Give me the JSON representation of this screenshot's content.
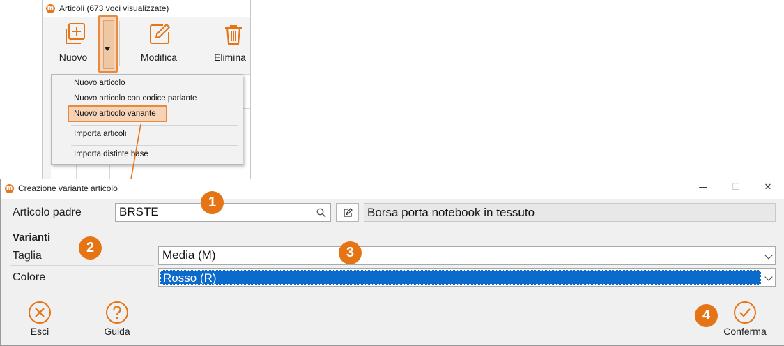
{
  "articoli_window": {
    "title": "Articoli (673 voci visualizzate)",
    "logo_text": "m",
    "toolbar": {
      "nuovo_label": "Nuovo",
      "modifica_label": "Modifica",
      "elimina_label": "Elimina"
    },
    "menu": {
      "items": [
        "Nuovo articolo",
        "Nuovo articolo con codice parlante",
        "Nuovo articolo variante",
        "Importa articoli",
        "Importa distinte base"
      ],
      "highlighted_index": 2
    }
  },
  "dialog": {
    "title": "Creazione variante articolo",
    "logo_text": "m",
    "controls": {
      "minimize": "—",
      "maximize": "☐",
      "close": "✕"
    },
    "articolo_padre": {
      "label": "Articolo padre",
      "code": "BRSTE",
      "description": "Borsa porta notebook in tessuto"
    },
    "varianti": {
      "heading": "Varianti",
      "rows": [
        {
          "label": "Taglia",
          "value": "Media (M)"
        },
        {
          "label": "Colore",
          "value": "Rosso (R)"
        }
      ]
    },
    "footer": {
      "esci_label": "Esci",
      "guida_label": "Guida",
      "conferma_label": "Conferma"
    }
  },
  "badges": [
    "1",
    "2",
    "3",
    "4"
  ],
  "colors": {
    "accent_orange": "#e57415",
    "highlight_fill": "#f6d3b6",
    "selection_blue": "#0a6bcc",
    "dialog_bg": "#f0f0f0"
  },
  "icons": {
    "toolbar": [
      "add-square-icon",
      "caret-down-icon",
      "edit-icon",
      "trash-icon"
    ],
    "fields": [
      "search-icon",
      "open-edit-icon",
      "chevron-down-icon"
    ],
    "footer": [
      "close-circle-icon",
      "help-circle-icon",
      "check-circle-icon"
    ]
  }
}
